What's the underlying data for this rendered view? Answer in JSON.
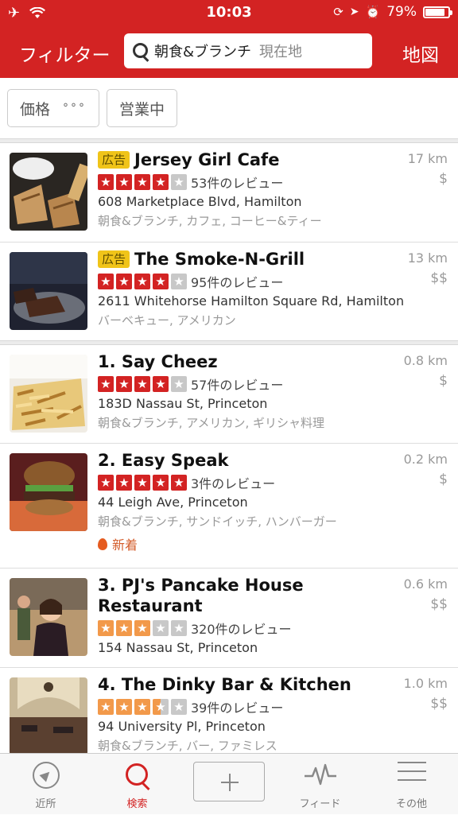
{
  "status": {
    "time": "10:03",
    "battery": "79%"
  },
  "nav": {
    "filter": "フィルター",
    "search_query": "朝食&ブランチ",
    "search_location": "現在地",
    "map": "地図"
  },
  "chips": {
    "price": "価格",
    "price_dots": "°°°",
    "open": "営業中"
  },
  "colors": {
    "brand_red": "#d32323",
    "star_red": "#d32323",
    "star_orange": "#f2994a",
    "star_gray": "#c8c8c8"
  },
  "listings": [
    {
      "ad": "広告",
      "title": "Jersey Girl Cafe",
      "rating": 4,
      "reviews": "53件のレビュー",
      "address": "608 Marketplace Blvd, Hamilton",
      "categories": "朝食&ブランチ, カフェ, コーヒー&ティー",
      "distance": "17 km",
      "price": "$"
    },
    {
      "ad": "広告",
      "title": "The Smoke-N-Grill",
      "rating": 4,
      "reviews": "95件のレビュー",
      "address": "2611 Whitehorse Hamilton Square Rd, Hamilton",
      "categories": "バーベキュー, アメリカン",
      "distance": "13 km",
      "price": "$$"
    },
    {
      "title": "1. Say Cheez",
      "rating": 4,
      "reviews": "57件のレビュー",
      "address": "183D Nassau St, Princeton",
      "categories": "朝食&ブランチ, アメリカン, ギリシャ料理",
      "distance": "0.8 km",
      "price": "$"
    },
    {
      "title": "2. Easy Speak",
      "rating": 5,
      "reviews": "3件のレビュー",
      "address": "44 Leigh Ave, Princeton",
      "categories": "朝食&ブランチ, サンドイッチ, ハンバーガー",
      "distance": "0.2 km",
      "price": "$",
      "badge": "新着"
    },
    {
      "title_line1": "3. PJ's Pancake House",
      "title_line2": "Restaurant",
      "rating": 3,
      "reviews": "320件のレビュー",
      "address": "154 Nassau St, Princeton",
      "distance": "0.6 km",
      "price": "$$"
    },
    {
      "title": "4. The Dinky Bar & Kitchen",
      "rating": 3.5,
      "reviews": "39件のレビュー",
      "address": "94 University Pl, Princeton",
      "categories": "朝食&ブランチ, バー, ファミレス",
      "distance": "1.0 km",
      "price": "$$"
    }
  ],
  "tabs": {
    "nearby": "近所",
    "search": "検索",
    "feed": "フィード",
    "more": "その他"
  }
}
